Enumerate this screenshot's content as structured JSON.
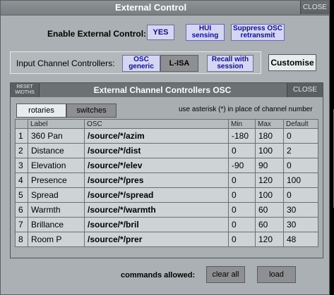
{
  "window": {
    "title": "External Control",
    "close_label": "CLOSE"
  },
  "enable": {
    "label": "Enable External Control:",
    "buttons": [
      {
        "label": "YES"
      },
      {
        "label": "HUI sensing"
      },
      {
        "label": "Suppress OSC retransmit"
      }
    ]
  },
  "input_controllers": {
    "label": "Input Channel Controllers:",
    "buttons": [
      {
        "label": "OSC generic"
      },
      {
        "label": "L-ISA"
      },
      {
        "label": "Recall with session"
      }
    ],
    "customise_label": "Customise"
  },
  "osc_window": {
    "title": "External Channel Controllers OSC",
    "reset_label": "RESET WIDTHS",
    "close_label": "CLOSE",
    "tabs": [
      {
        "label": "rotaries"
      },
      {
        "label": "switches"
      }
    ],
    "hint": "use asterisk (*) in place of channel number",
    "columns": [
      "",
      "Label",
      "OSC",
      "Min",
      "Max",
      "Default"
    ],
    "rows": [
      {
        "idx": "1",
        "label": "360 Pan",
        "osc": "/source/*/azim",
        "min": "-180",
        "max": "180",
        "default": "0"
      },
      {
        "idx": "2",
        "label": "Distance",
        "osc": "/source/*/dist",
        "min": "0",
        "max": "100",
        "default": "2"
      },
      {
        "idx": "3",
        "label": "Elevation",
        "osc": "/source/*/elev",
        "min": "-90",
        "max": "90",
        "default": "0"
      },
      {
        "idx": "4",
        "label": "Presence",
        "osc": "/source/*/pres",
        "min": "0",
        "max": "120",
        "default": "100"
      },
      {
        "idx": "5",
        "label": "Spread",
        "osc": "/source/*/spread",
        "min": "0",
        "max": "100",
        "default": "0"
      },
      {
        "idx": "6",
        "label": "Warmth",
        "osc": "/source/*/warmth",
        "min": "0",
        "max": "60",
        "default": "30"
      },
      {
        "idx": "7",
        "label": "Brillance",
        "osc": "/source/*/bril",
        "min": "0",
        "max": "60",
        "default": "30"
      },
      {
        "idx": "8",
        "label": "Room P",
        "osc": "/source/*/prer",
        "min": "0",
        "max": "120",
        "default": "48"
      }
    ]
  },
  "footer": {
    "label": "commands allowed:",
    "clear_all_label": "clear all",
    "load_label": "load"
  }
}
